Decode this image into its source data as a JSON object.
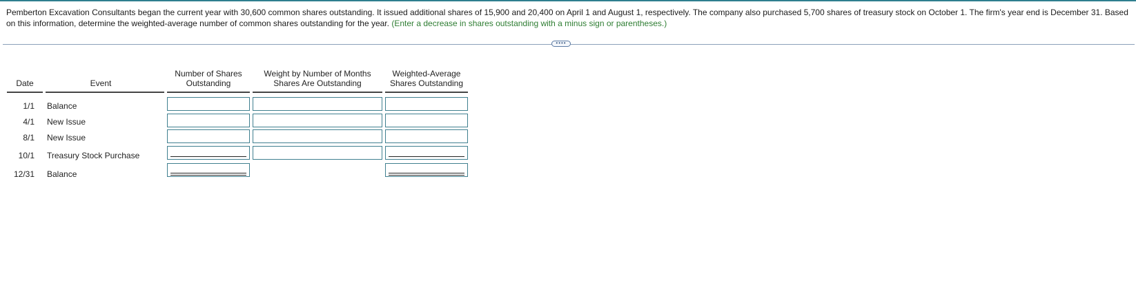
{
  "question": {
    "text": "Pemberton Excavation Consultants began the current year with 30,600 common shares outstanding. It issued additional shares of 15,900 and 20,400 on April 1 and August 1, respectively. The company also purchased 5,700 shares of treasury stock on October 1. The firm's year end is December 31. Based on this information, determine the weighted-average number of common shares outstanding for the year.",
    "hint": "(Enter a decrease in shares outstanding with a minus sign or parentheses.)"
  },
  "more_button": "••••",
  "table": {
    "headers": {
      "date": "Date",
      "event": "Event",
      "shares_line1": "Number of Shares",
      "shares_line2": "Outstanding",
      "weight_line1": "Weight by Number of Months",
      "weight_line2": "Shares Are Outstanding",
      "wavg_line1": "Weighted-Average",
      "wavg_line2": "Shares Outstanding"
    },
    "rows": [
      {
        "date": "1/1",
        "event": "Balance",
        "shares": "",
        "weight": "",
        "wavg": ""
      },
      {
        "date": "4/1",
        "event": "New Issue",
        "shares": "",
        "weight": "",
        "wavg": ""
      },
      {
        "date": "8/1",
        "event": "New Issue",
        "shares": "",
        "weight": "",
        "wavg": ""
      },
      {
        "date": "10/1",
        "event": "Treasury Stock Purchase",
        "shares": "",
        "weight": "",
        "wavg": ""
      },
      {
        "date": "12/31",
        "event": "Balance",
        "shares": "",
        "wavg": ""
      }
    ]
  }
}
